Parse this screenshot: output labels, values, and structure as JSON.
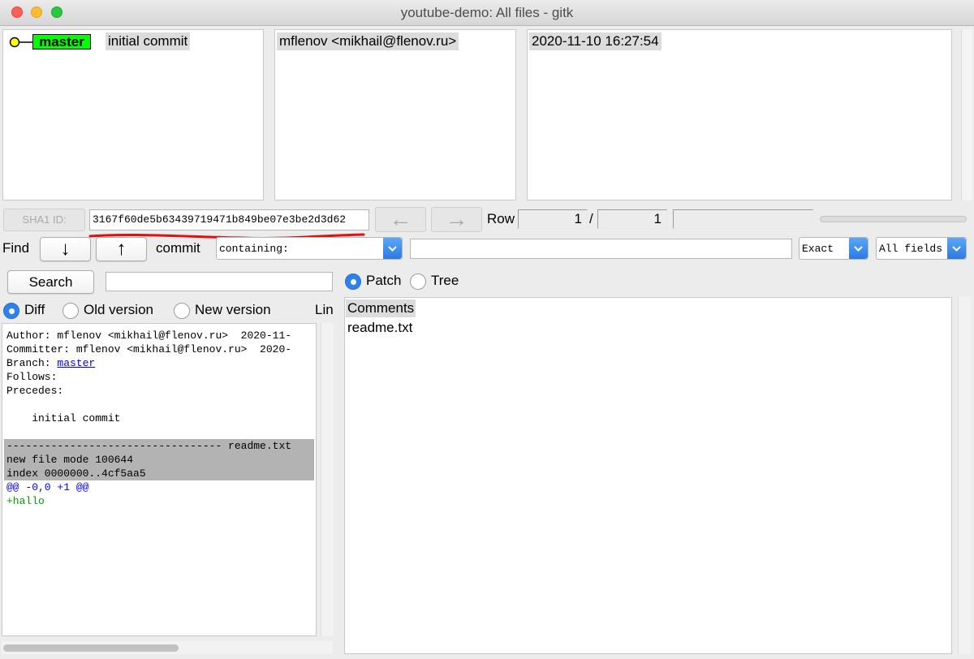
{
  "window": {
    "title": "youtube-demo: All files - gitk"
  },
  "commit_list": {
    "branch_tag": "master",
    "message": "initial commit",
    "author": "mflenov <mikhail@flenov.ru>",
    "date": "2020-11-10 16:27:54"
  },
  "sha": {
    "label": "SHA1 ID:",
    "value": "3167f60de5b63439719471b849be07e3be2d3d62"
  },
  "nav": {
    "back_glyph": "←",
    "forward_glyph": "→",
    "row_label": "Row",
    "row_current": "1",
    "row_sep": "/",
    "row_total": "1"
  },
  "find": {
    "label": "Find",
    "down_glyph": "↓",
    "up_glyph": "↑",
    "commit_label": "commit",
    "type_value": "containing:",
    "query_value": "",
    "match_value": "Exact",
    "fields_value": "All fields"
  },
  "search": {
    "button_label": "Search",
    "input_value": ""
  },
  "diff_mode": {
    "diff_label": "Diff",
    "old_label": "Old version",
    "new_label": "New version",
    "lines_label": "Lin"
  },
  "file_tabs": {
    "patch_label": "Patch",
    "tree_label": "Tree"
  },
  "details": {
    "author_line": "Author: mflenov <mikhail@flenov.ru>  2020-11-",
    "committer_line": "Committer: mflenov <mikhail@flenov.ru>  2020-",
    "branch_prefix": "Branch: ",
    "branch_link": "master",
    "follows_line": "Follows:",
    "precedes_line": "Precedes:",
    "message_line": "    initial commit",
    "file_sep_line": "---------------------------------- readme.txt",
    "mode_line": "new file mode 100644",
    "index_line": "index 0000000..4cf5aa5",
    "hunk_line": "@@ -0,0 +1 @@",
    "added_line": "+hallo"
  },
  "files": {
    "items": [
      "Comments",
      "readme.txt"
    ]
  },
  "colors": {
    "branch_tag": "#00ff00",
    "diff_header_bg": "#b3b3b3",
    "hunk": "#0000ff",
    "added": "#00a000",
    "link": "#0000ee",
    "radio_selected": "#2f80ed",
    "annotation_underline": "#e01010"
  }
}
